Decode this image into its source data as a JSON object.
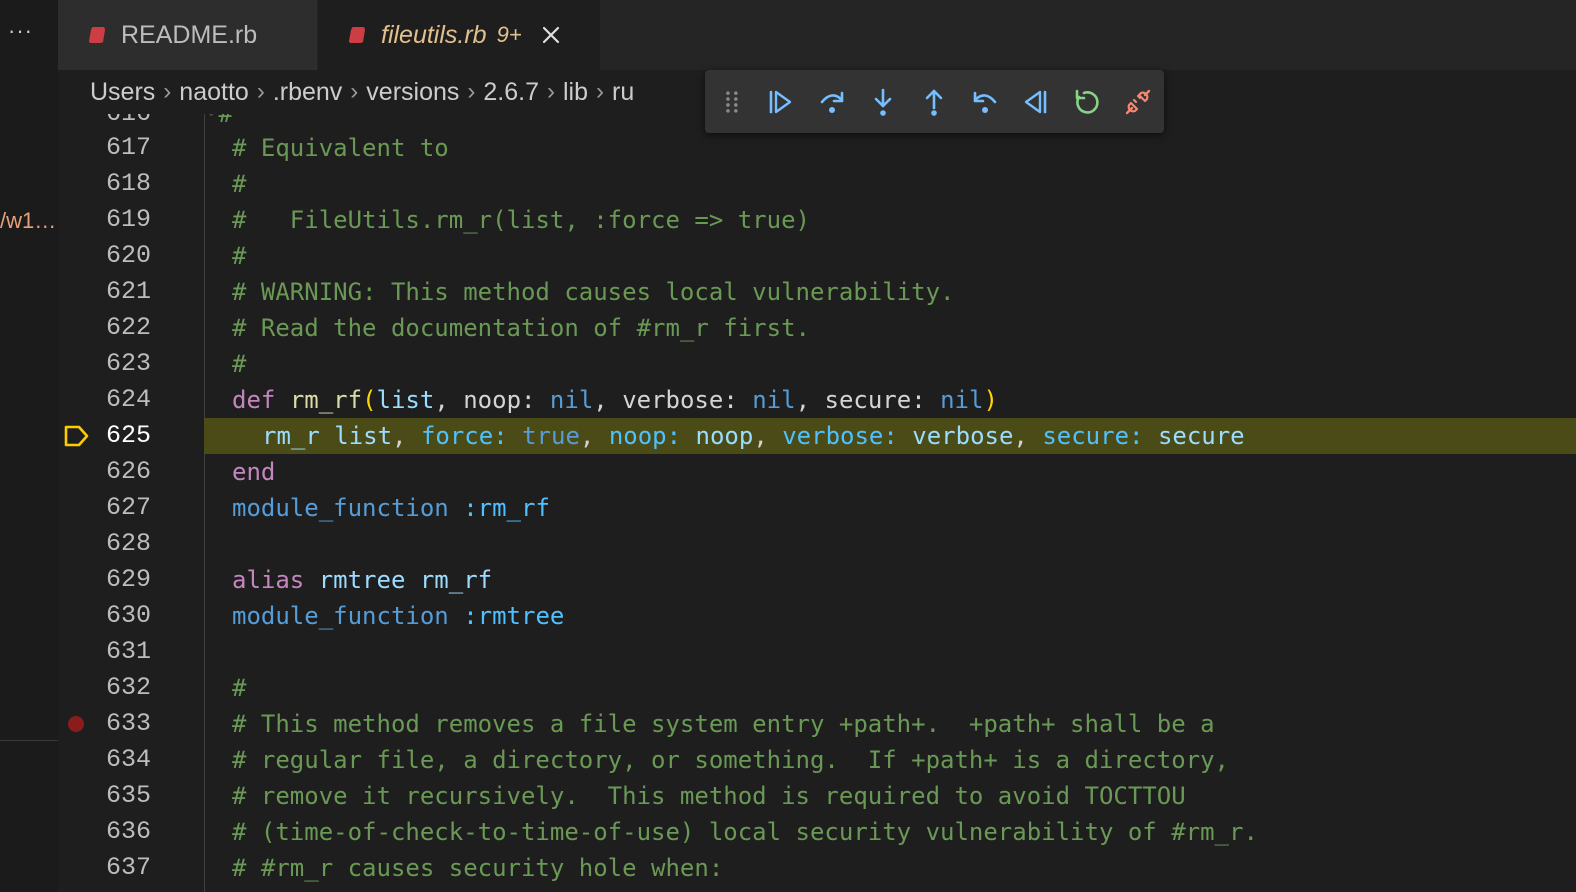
{
  "left_panel": {
    "more_label": "···",
    "path_fragment": "/w1…"
  },
  "tabs": [
    {
      "label": "README.rb",
      "active": false
    },
    {
      "label": "fileutils.rb",
      "badge": "9+",
      "active": true
    }
  ],
  "breadcrumb": [
    "Users",
    "naotto",
    ".rbenv",
    "versions",
    "2.6.7",
    "lib",
    "ru"
  ],
  "debug_toolbar": {
    "buttons": [
      "continue",
      "step-over",
      "step-into",
      "step-out",
      "step-back",
      "reverse-continue",
      "restart",
      "disconnect"
    ]
  },
  "editor": {
    "top_partial_line": "616",
    "lines": [
      {
        "num": "617",
        "text": "# Equivalent to"
      },
      {
        "num": "618",
        "text": "#"
      },
      {
        "num": "619",
        "text": "#   FileUtils.rm_r(list, :force => true)"
      },
      {
        "num": "620",
        "text": "#"
      },
      {
        "num": "621",
        "text": "# WARNING: This method causes local vulnerability."
      },
      {
        "num": "622",
        "text": "# Read the documentation of #rm_r first."
      },
      {
        "num": "623",
        "text": "#"
      },
      {
        "num": "624",
        "text": "def rm_rf(list, noop: nil, verbose: nil, secure: nil)"
      },
      {
        "num": "625",
        "text": "  rm_r list, force: true, noop: noop, verbose: verbose, secure: secure"
      },
      {
        "num": "626",
        "text": "end"
      },
      {
        "num": "627",
        "text": "module_function :rm_rf"
      },
      {
        "num": "628",
        "text": ""
      },
      {
        "num": "629",
        "text": "alias rmtree rm_rf"
      },
      {
        "num": "630",
        "text": "module_function :rmtree"
      },
      {
        "num": "631",
        "text": ""
      },
      {
        "num": "632",
        "text": "#"
      },
      {
        "num": "633",
        "text": "# This method removes a file system entry +path+.  +path+ shall be a"
      },
      {
        "num": "634",
        "text": "# regular file, a directory, or something.  If +path+ is a directory,"
      },
      {
        "num": "635",
        "text": "# remove it recursively.  This method is required to avoid TOCTTOU"
      },
      {
        "num": "636",
        "text": "# (time-of-check-to-time-of-use) local security vulnerability of #rm_r."
      },
      {
        "num": "637",
        "text": "# #rm_r causes security hole when:"
      }
    ]
  },
  "colors": {
    "current_line_bg": "#4b4b18",
    "active_tab_text": "#e2c08d",
    "comment": "#6a9955",
    "keyword": "#c586c0",
    "breakpoint": "#8b1c1c"
  }
}
